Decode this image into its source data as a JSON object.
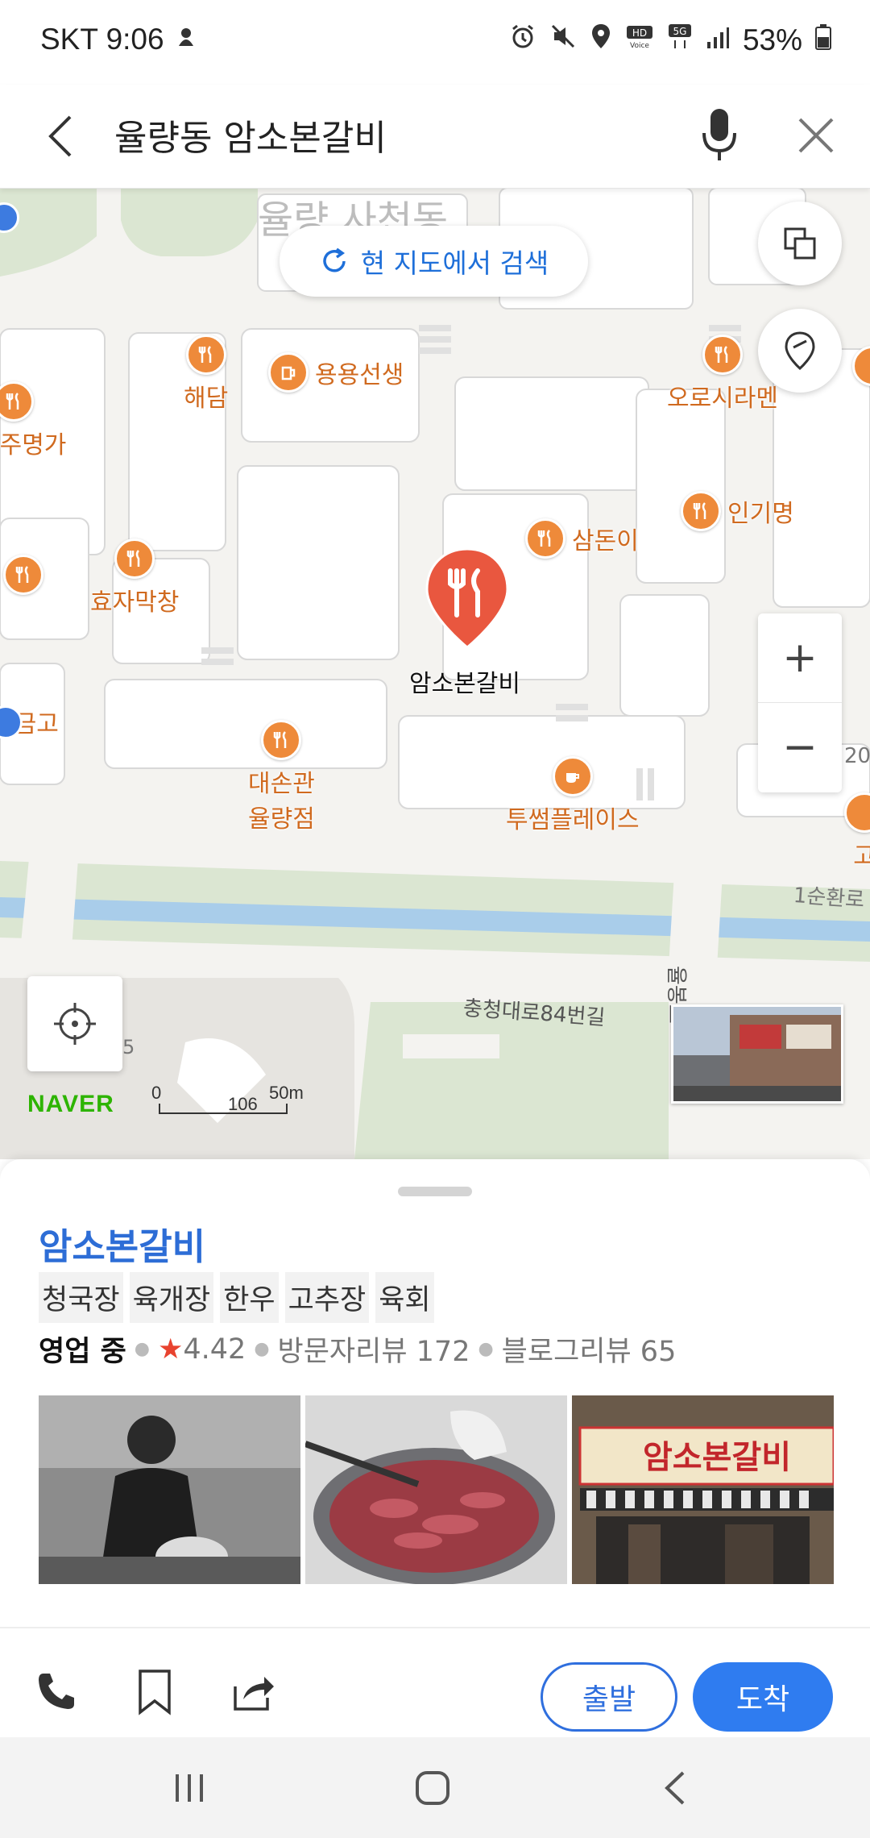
{
  "status_bar": {
    "carrier_time": "SKT 9:06",
    "battery": "53%"
  },
  "search": {
    "query": "율량동 암소본갈비"
  },
  "map": {
    "research_label": "현 지도에서 검색",
    "area_label": "율량 사천동",
    "road_label_1": "충청대로84번길",
    "road_label_2": "1순환로",
    "road_label_3": "율봉로",
    "pois": {
      "haedam": "해담",
      "yongyong": "용용선생",
      "orosi": "오로시라멘",
      "jumyeongga": "전주명가",
      "ingimyeong": "인기명",
      "samdoni": "삼돈이",
      "hyoja": "효자막창",
      "selected": "암소본갈비",
      "eulgeumgo": "을금고",
      "daeson_line1": "대손관",
      "daeson_line2": "율량점",
      "twosome": "투썸플레이스",
      "partial_right": "고",
      "partial_number": "20"
    },
    "naver_logo": "NAVER",
    "scale": {
      "zero": "0",
      "mid": "106",
      "end": "50m"
    },
    "map_number": "5"
  },
  "place": {
    "name": "암소본갈비",
    "tags": [
      "청국장",
      "육개장",
      "한우",
      "고추장",
      "육회"
    ],
    "status": "영업 중",
    "rating": "4.42",
    "visitor_reviews": "방문자리뷰 172",
    "blog_reviews": "블로그리뷰 65",
    "storefront_sign": "암소본갈비"
  },
  "actions": {
    "depart": "출발",
    "arrive": "도착"
  },
  "colors": {
    "accent": "#2f7cf0",
    "poi": "#ee8a3a",
    "selected_pin": "#e9573f",
    "open_green": "#2db400"
  }
}
